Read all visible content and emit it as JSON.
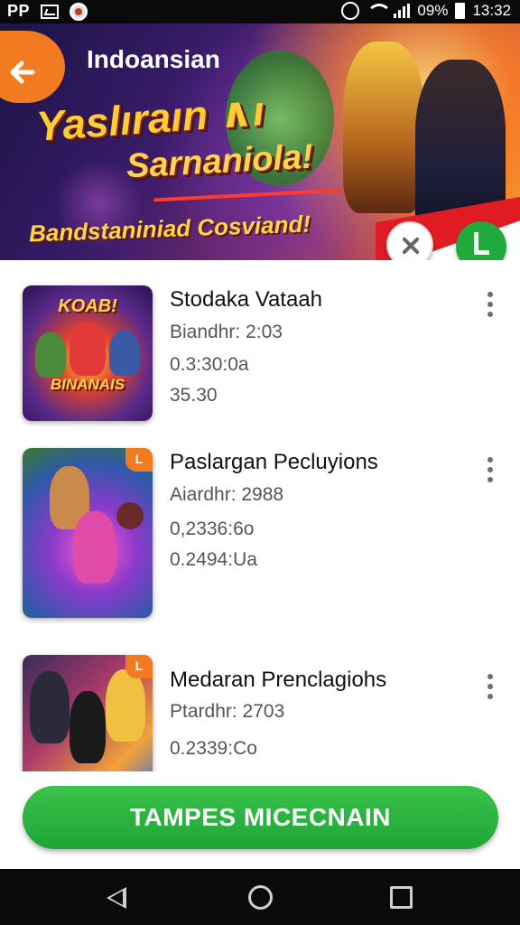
{
  "status_bar": {
    "left_text": "PP",
    "icons_left": [
      "image-icon",
      "notification-circle-icon"
    ],
    "battery_percent": "09%",
    "time": "13:32",
    "icons_right": [
      "alarm-icon",
      "wifi-icon",
      "signal-icon",
      "battery-icon"
    ]
  },
  "header": {
    "back_icon": "arrow-left-icon",
    "title": "Indoansian",
    "banner_title_line1": "Yaslıraın ∧ı",
    "banner_title_line2": "Sarnaniola!",
    "banner_subtitle": "Bandstaniniad Cosviand!",
    "close_icon": "close-icon",
    "action_icon": "checkmark-icon",
    "brand_color": "#f27a20",
    "action_color": "#1faa3b"
  },
  "games": [
    {
      "thumb_text_top": "KOAB!",
      "thumb_text_bottom": "BINANAIS",
      "title": "Stodaka Vataah",
      "meta_1": "Biandhr: 2:03",
      "meta_2": "0.3:30:0a",
      "meta_3": "35.30",
      "menu_icon": "kebab-menu-icon"
    },
    {
      "thumb_badge": "L",
      "title": "Paslargan Pecluyions",
      "meta_1": "Aiardhr: 2988",
      "meta_2": "0,2336:6o",
      "meta_3": "0.2494:Ua",
      "menu_icon": "kebab-menu-icon"
    },
    {
      "thumb_badge": "L",
      "title": "Medaran Prenclagiohs",
      "meta_1": "Ptardhr: 2703",
      "meta_2": "0.2339:Co",
      "meta_3": "",
      "menu_icon": "kebab-menu-icon"
    }
  ],
  "cta": {
    "label": "TAMPES MICECNAIN",
    "color": "#1fa535"
  },
  "nav_bar": {
    "icons": [
      "nav-back-icon",
      "nav-home-icon",
      "nav-recents-icon"
    ]
  }
}
